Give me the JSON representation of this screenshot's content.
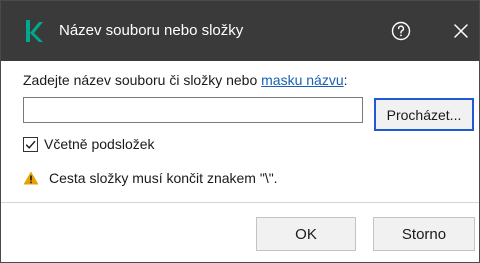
{
  "titlebar": {
    "title": "Název souboru nebo složky",
    "logo_icon": "kaspersky-k-icon",
    "help_icon": "help-circle-icon",
    "close_icon": "close-icon",
    "background": "#3a3a3a",
    "logo_color": "#00a88e"
  },
  "form": {
    "prompt_prefix": "Zadejte název souboru či složky nebo ",
    "prompt_link": "masku názvu",
    "prompt_suffix": ":",
    "name_value": "",
    "browse_label": "Procházet...",
    "include_subfolders_label": "Včetně podsložek",
    "include_subfolders_checked": true
  },
  "warning": {
    "icon": "warning-triangle-icon",
    "icon_color": "#e8a200",
    "text": "Cesta složky musí končit znakem \"\\\"."
  },
  "footer": {
    "ok_label": "OK",
    "cancel_label": "Storno"
  },
  "colors": {
    "accent": "#1f5ad6",
    "link": "#1a5fb4"
  }
}
